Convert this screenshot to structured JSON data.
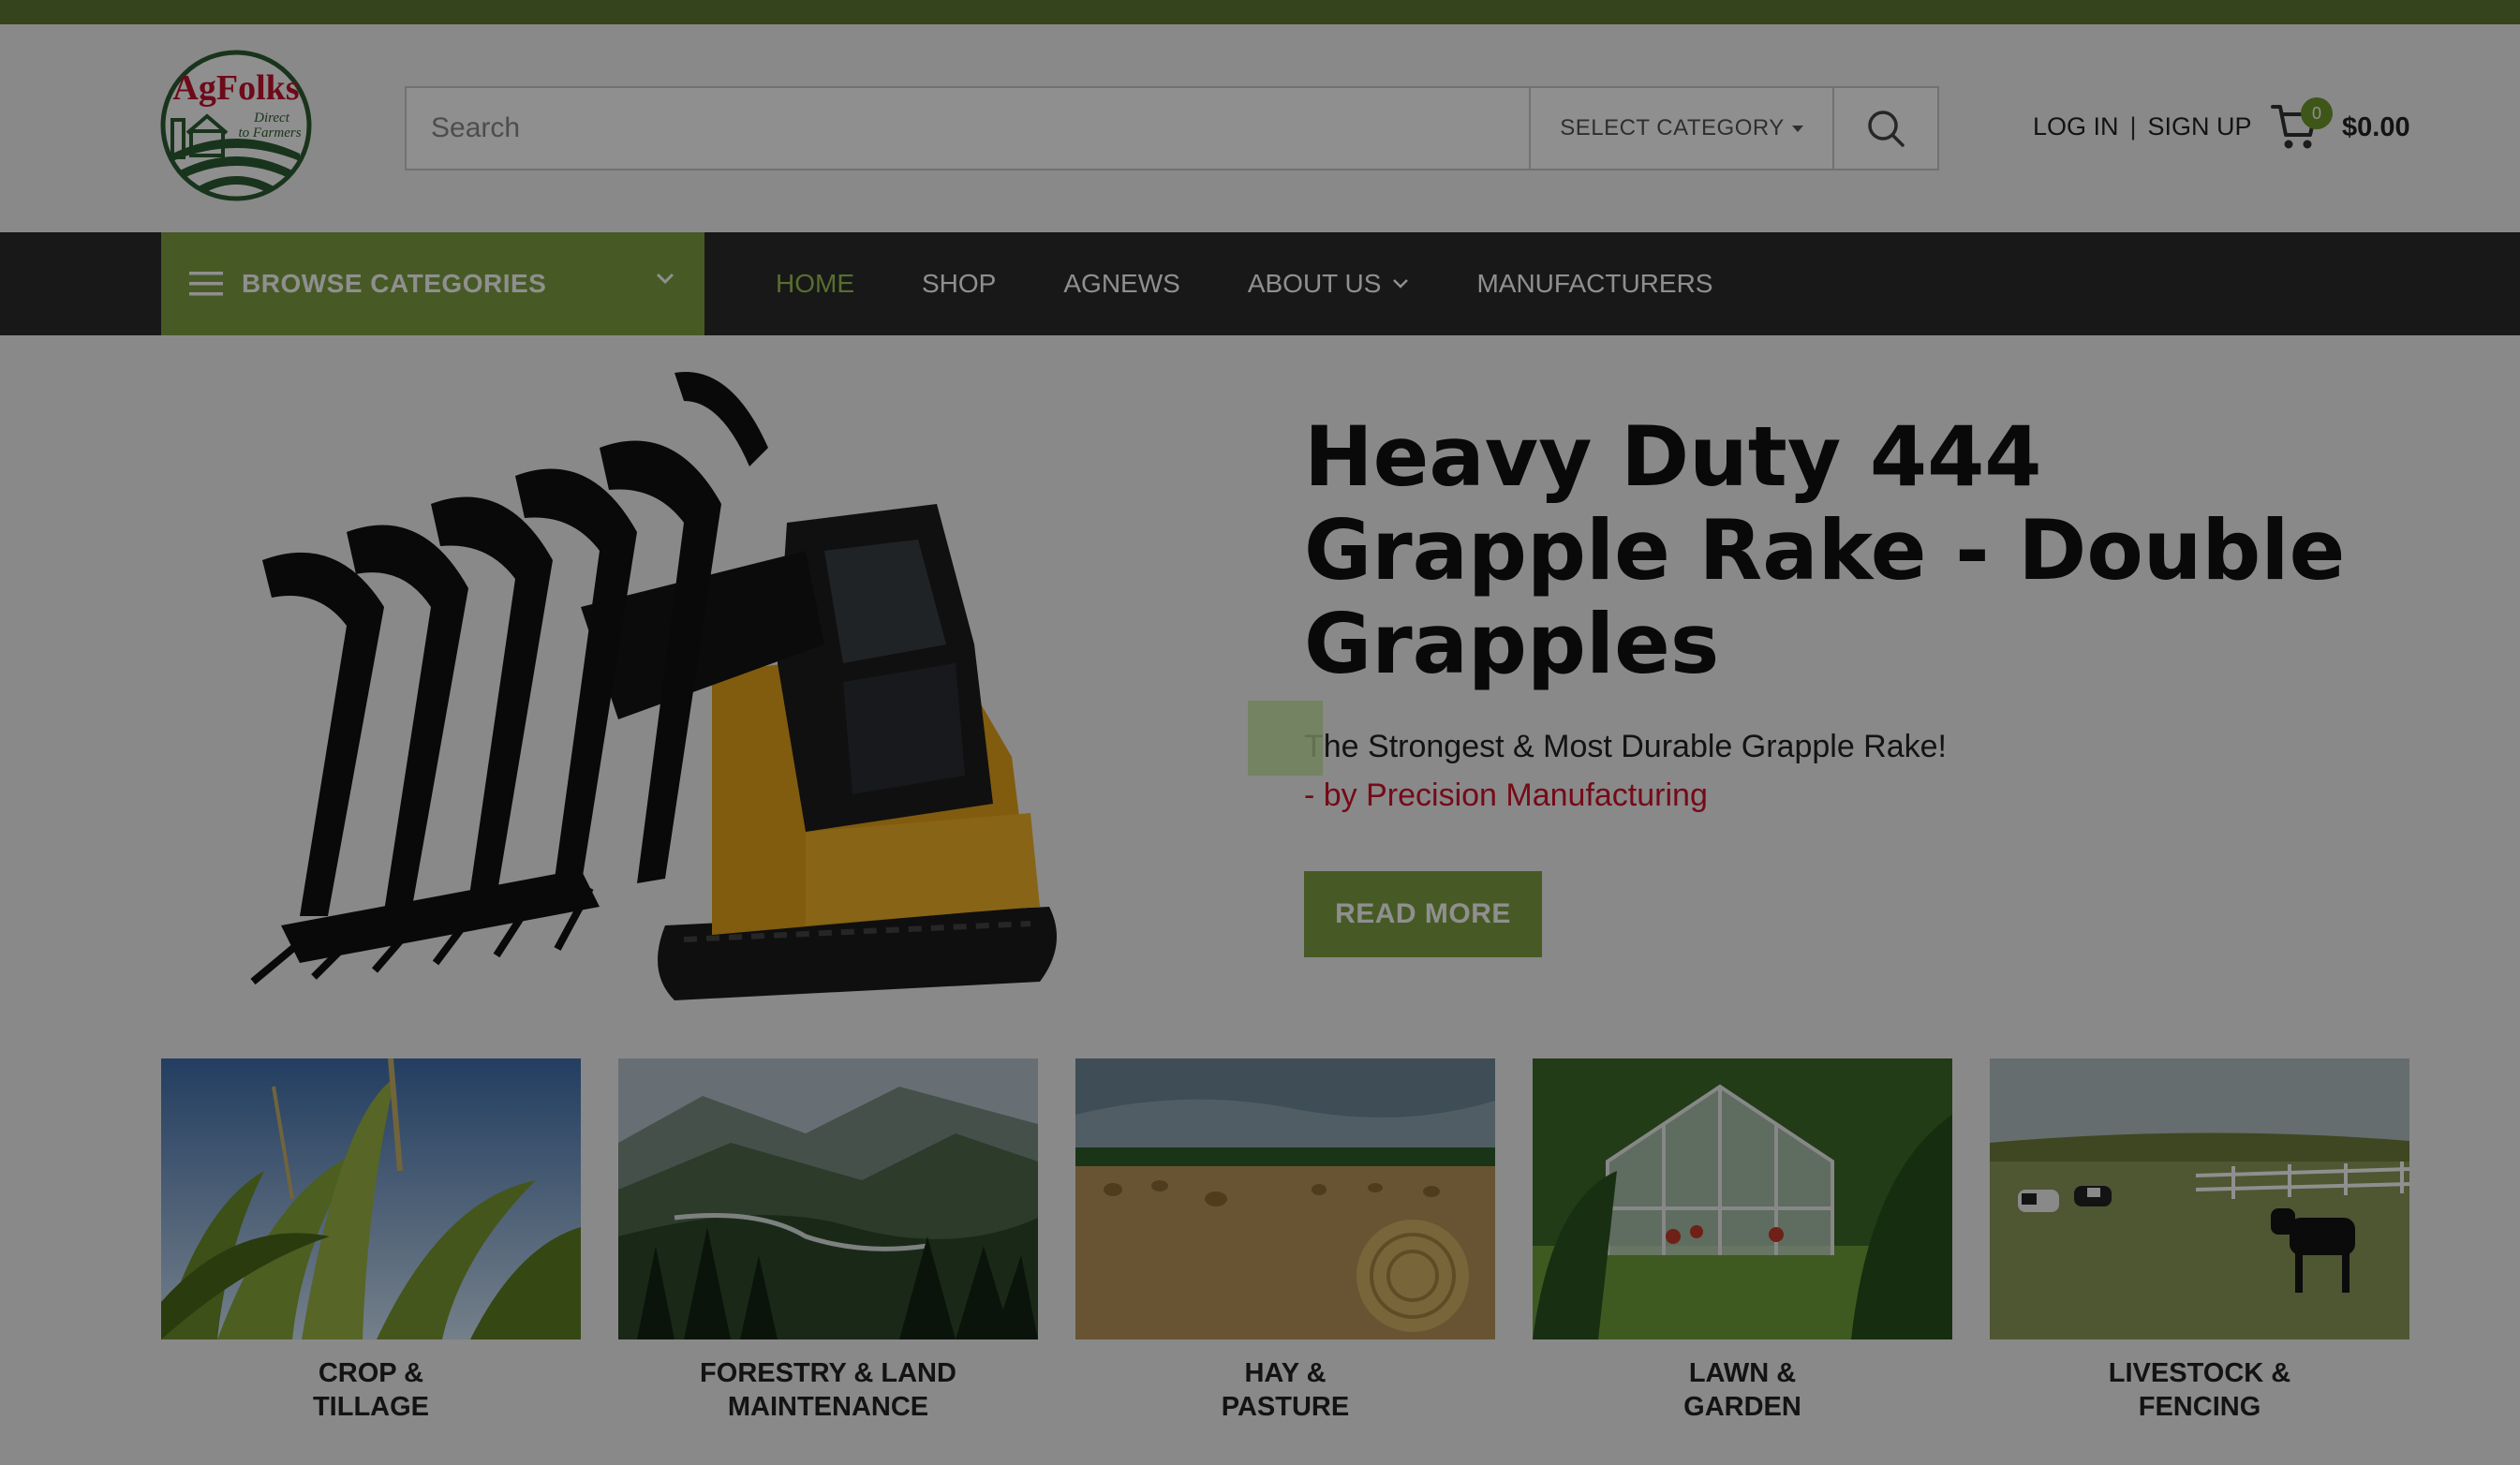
{
  "brand": {
    "name": "AgFolks",
    "tagline_line1": "Direct",
    "tagline_line2": "to Farmers",
    "accent": "#7fa142",
    "red": "#c4122e"
  },
  "search": {
    "placeholder": "Search",
    "category_label": "SELECT CATEGORY"
  },
  "account": {
    "login": "LOG IN",
    "separator": "|",
    "signup": "SIGN UP"
  },
  "cart": {
    "count": "0",
    "total": "$0.00"
  },
  "nav": {
    "browse_label": "BROWSE CATEGORIES",
    "items": [
      {
        "label": "HOME",
        "active": true
      },
      {
        "label": "SHOP",
        "active": false
      },
      {
        "label": "AGNEWS",
        "active": false
      },
      {
        "label": "ABOUT US",
        "active": false
      },
      {
        "label": "MANUFACTURERS",
        "active": false
      }
    ]
  },
  "hero": {
    "title": "Heavy Duty 444 Grapple Rake - Double Grapples",
    "subtitle": "The Strongest & Most Durable Grapple Rake!",
    "byline": "- by Precision Manufacturing",
    "cta": "READ MORE"
  },
  "categories": [
    {
      "label": "CROP &\nTILLAGE"
    },
    {
      "label": "FORESTRY & LAND\nMAINTENANCE"
    },
    {
      "label": "HAY &\nPASTURE"
    },
    {
      "label": "LAWN &\nGARDEN"
    },
    {
      "label": "LIVESTOCK &\nFENCING"
    }
  ],
  "icons": {
    "search": "search-icon",
    "cart": "cart-icon",
    "menu": "hamburger-icon",
    "chevron": "chevron-down-icon"
  }
}
